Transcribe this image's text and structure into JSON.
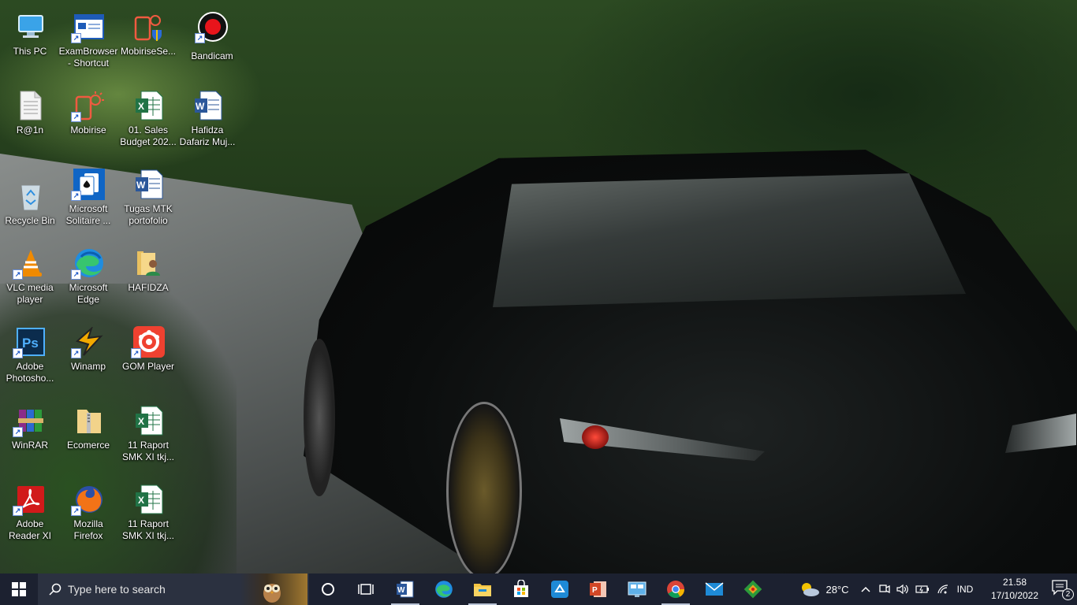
{
  "desktop": {
    "icons": [
      {
        "label": "This PC"
      },
      {
        "label": "ExamBrowser - Shortcut"
      },
      {
        "label": "MobiriseSe..."
      },
      {
        "label": "Bandicam"
      },
      {
        "label": "R@1n"
      },
      {
        "label": "Mobirise"
      },
      {
        "label": "01. Sales Budget 202..."
      },
      {
        "label": "Hafidza Dafariz Muj..."
      },
      {
        "label": "Recycle Bin"
      },
      {
        "label": "Microsoft Solitaire ..."
      },
      {
        "label": "Tugas MTK portofolio"
      },
      {
        "label": "VLC media player"
      },
      {
        "label": "Microsoft Edge"
      },
      {
        "label": "HAFIDZA"
      },
      {
        "label": "Adobe Photosho..."
      },
      {
        "label": "Winamp"
      },
      {
        "label": "GOM Player"
      },
      {
        "label": "WinRAR"
      },
      {
        "label": "Ecomerce"
      },
      {
        "label": "11 Raport SMK XI tkj..."
      },
      {
        "label": "Adobe Reader XI"
      },
      {
        "label": "Mozilla Firefox"
      },
      {
        "label": "11 Raport SMK XI tkj..."
      }
    ]
  },
  "taskbar": {
    "search_placeholder": "Type here to search",
    "weather_temp": "28°C",
    "language": "IND",
    "time": "21.58",
    "date": "17/10/2022",
    "notification_count": "2",
    "pinned": [
      "cortana-icon",
      "task-view-icon",
      "word-icon",
      "edge-icon",
      "file-explorer-icon",
      "microsoft-store-icon",
      "recycle-app-icon",
      "powerpoint-icon",
      "control-panel-icon",
      "chrome-icon",
      "mail-icon",
      "git-icon"
    ]
  },
  "colors": {
    "taskbar_bg": "#1c2130",
    "search_bg": "#2b3140",
    "word_blue": "#2b579a",
    "excel_green": "#217346",
    "ppt_orange": "#d24726"
  }
}
